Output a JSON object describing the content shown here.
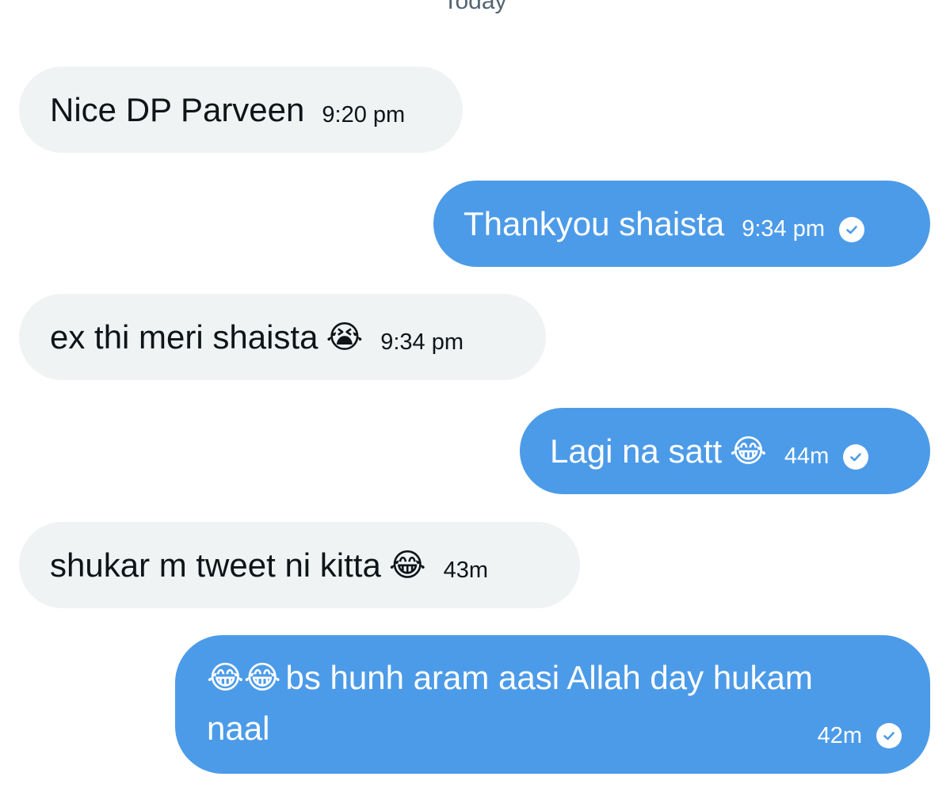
{
  "conversation": {
    "day_label": "Today",
    "messages": [
      {
        "direction": "incoming",
        "text": "Nice DP Parveen",
        "emoji": "",
        "time": "9:20 pm"
      },
      {
        "direction": "outgoing",
        "text": "Thankyou shaista",
        "emoji": "",
        "time": "9:34 pm",
        "status": "seen"
      },
      {
        "direction": "incoming",
        "text": "ex thi meri shaista",
        "emoji": "😭",
        "time": "9:34 pm"
      },
      {
        "direction": "outgoing",
        "text": "Lagi na satt",
        "emoji": "😂",
        "time": "44m",
        "status": "seen"
      },
      {
        "direction": "incoming",
        "text": "shukar m tweet ni kitta",
        "emoji": "😂",
        "time": "43m"
      },
      {
        "direction": "outgoing",
        "emoji_lead": "😂😂",
        "text_line1": "bs hunh aram aasi Allah day hukam",
        "text_line2": "naal",
        "time": "42m",
        "status": "seen"
      }
    ]
  },
  "colors": {
    "incoming_bubble": "#eff3f4",
    "outgoing_bubble": "#4c9be8",
    "incoming_text": "#0f1419",
    "outgoing_text": "#ffffff",
    "timestamp_header": "#536471"
  },
  "icons": {
    "read_receipt": "check-circle-icon"
  }
}
